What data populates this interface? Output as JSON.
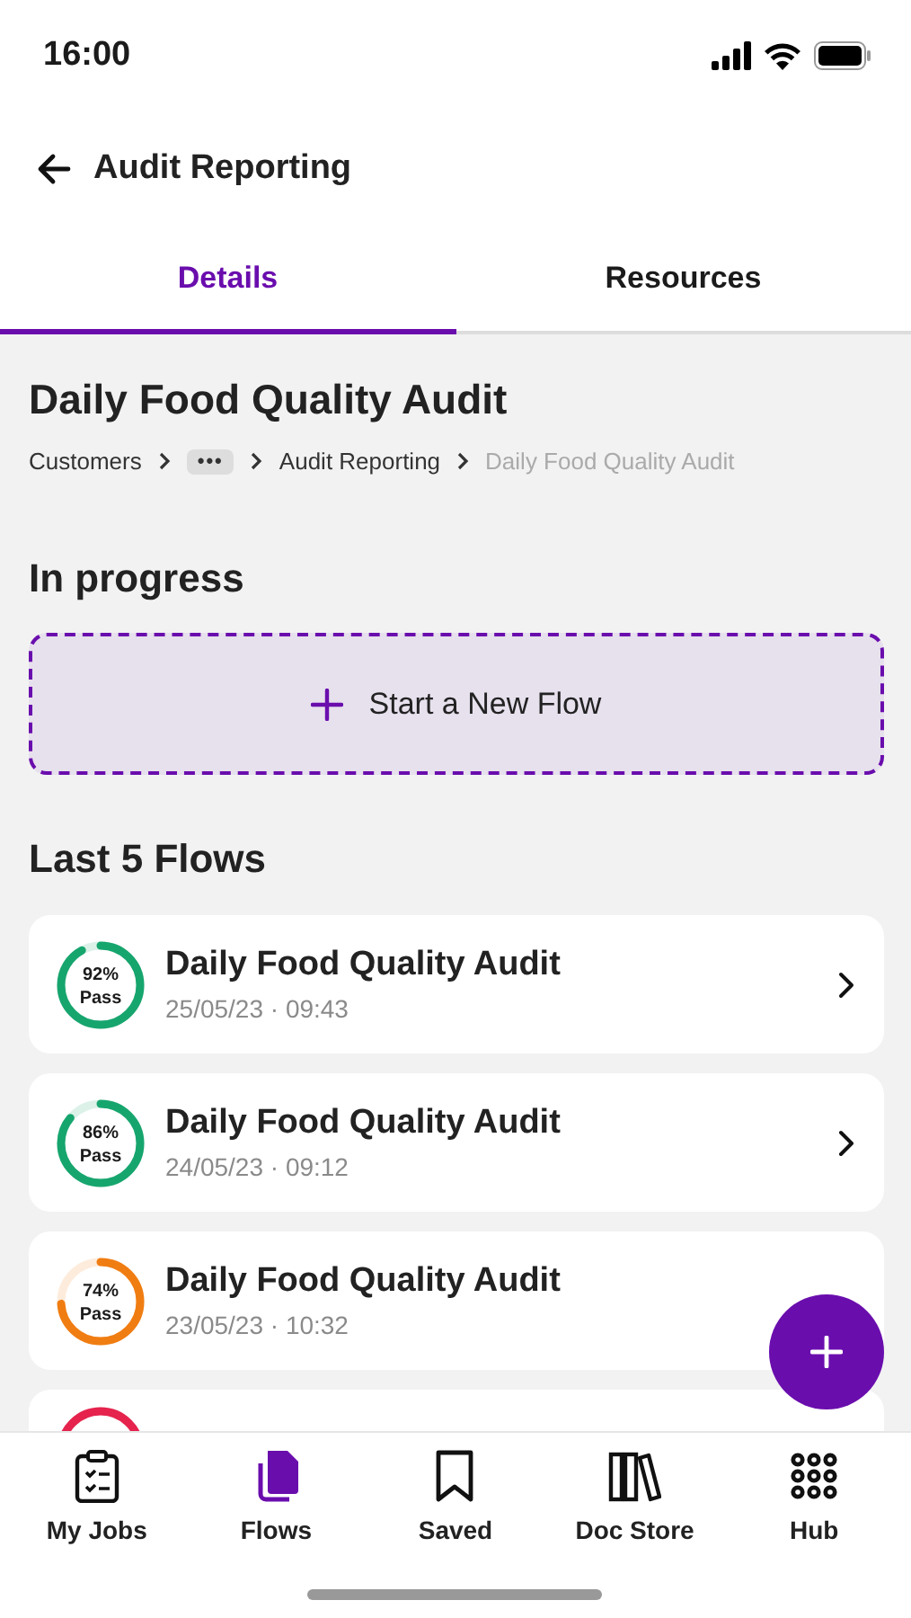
{
  "status_bar": {
    "time": "16:00"
  },
  "header": {
    "title": "Audit Reporting"
  },
  "tabs": [
    {
      "label": "Details",
      "selected": true
    },
    {
      "label": "Resources",
      "selected": false
    }
  ],
  "page_title": "Daily Food Quality Audit",
  "breadcrumb": [
    {
      "label": "Customers",
      "kind": "link"
    },
    {
      "label": "•••",
      "kind": "more"
    },
    {
      "label": "Audit Reporting",
      "kind": "link"
    },
    {
      "label": "Daily Food Quality Audit",
      "kind": "current"
    }
  ],
  "in_progress": {
    "heading": "In progress",
    "new_flow_button": "Start a New Flow"
  },
  "last_flows": {
    "heading": "Last 5 Flows",
    "items": [
      {
        "title": "Daily Food Quality Audit",
        "date": "25/05/23 · 09:43",
        "score": "92%",
        "result": "Pass",
        "level": 0.92,
        "color": "#17a56e",
        "chevron": true
      },
      {
        "title": "Daily Food Quality Audit",
        "date": "24/05/23 · 09:12",
        "score": "86%",
        "result": "Pass",
        "level": 0.86,
        "color": "#17a56e",
        "chevron": true
      },
      {
        "title": "Daily Food Quality Audit",
        "date": "23/05/23 · 10:32",
        "score": "74%",
        "result": "Pass",
        "level": 0.74,
        "color": "#f07d12",
        "chevron": false
      },
      {
        "color": "#e5234d",
        "chevron": false
      }
    ]
  },
  "bottom_nav": [
    {
      "label": "My Jobs",
      "selected": false
    },
    {
      "label": "Flows",
      "selected": true
    },
    {
      "label": "Saved",
      "selected": false
    },
    {
      "label": "Doc Store",
      "selected": false
    },
    {
      "label": "Hub",
      "selected": false
    }
  ]
}
